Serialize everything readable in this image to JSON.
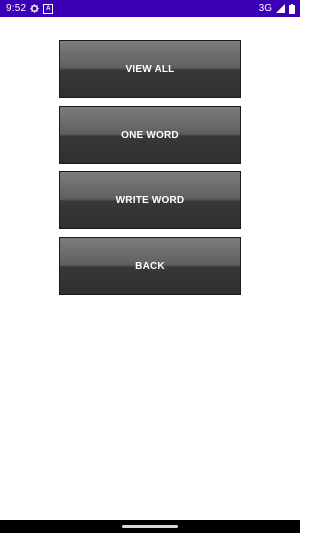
{
  "status_bar": {
    "time": "9:52",
    "network": "3G",
    "icons": [
      "settings-gear-icon",
      "a-notification-icon",
      "signal-icon",
      "battery-icon"
    ]
  },
  "menu": {
    "buttons": [
      {
        "label": "VIEW ALL"
      },
      {
        "label": "ONE WORD"
      },
      {
        "label": "WRITE WORD"
      },
      {
        "label": "BACK"
      }
    ]
  },
  "colors": {
    "status_bar_bg": "#3a00b5",
    "button_top": "#7c7c7c",
    "button_bottom": "#2f2f2f",
    "background": "#ffffff",
    "nav_bar": "#000000"
  }
}
